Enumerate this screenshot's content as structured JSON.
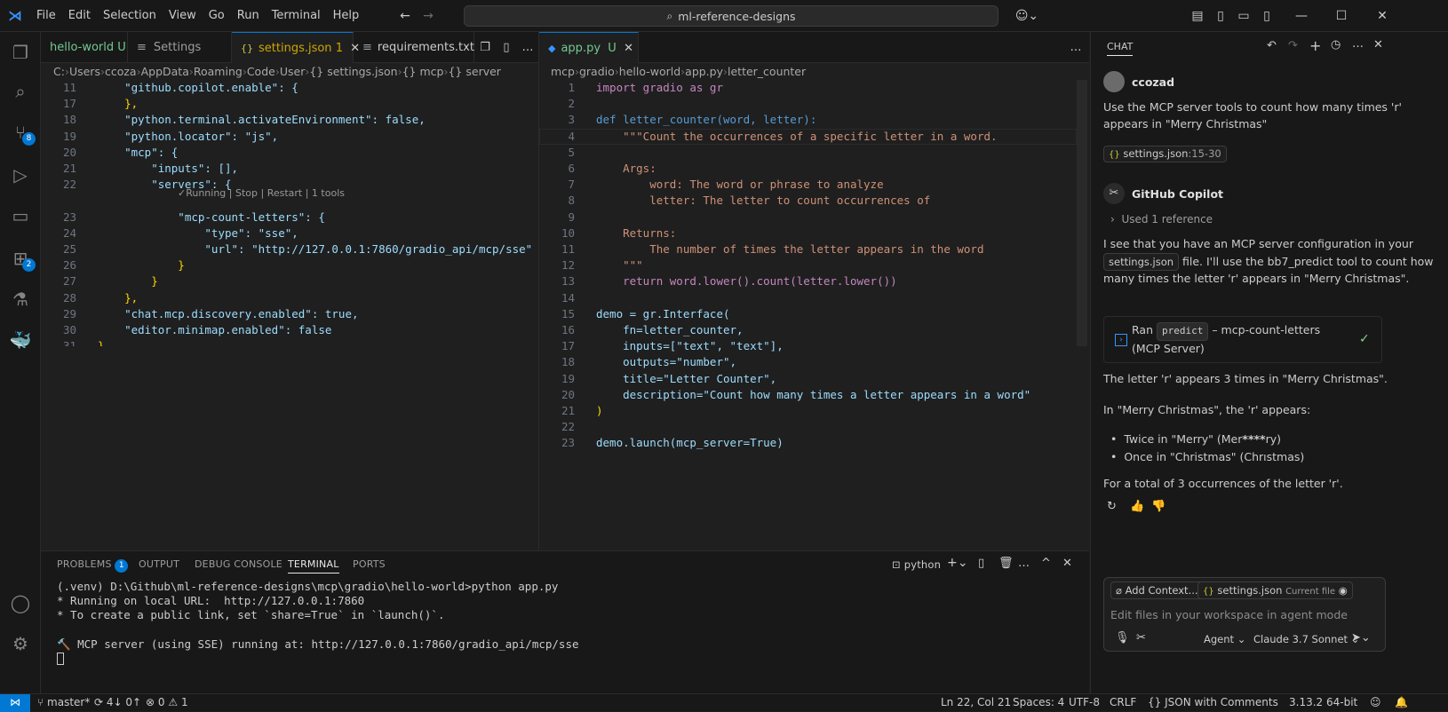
{
  "menu": [
    "File",
    "Edit",
    "Selection",
    "View",
    "Go",
    "Run",
    "Terminal",
    "Help"
  ],
  "search": "ml-reference-designs",
  "left_tabs": [
    {
      "label": "hello-world",
      "suffix": "U",
      "icon": ""
    },
    {
      "label": "Settings",
      "icon": "≡"
    },
    {
      "label": "settings.json",
      "suffix": "1",
      "icon": "{}"
    },
    {
      "label": "requirements.txt",
      "icon": "≡"
    }
  ],
  "right_tabs": [
    {
      "label": "app.py",
      "suffix": "U",
      "icon": "py"
    }
  ],
  "left_breadcrumb": [
    "C:",
    "Users",
    "ccoza",
    "AppData",
    "Roaming",
    "Code",
    "User",
    "{} settings.json",
    "{} mcp",
    "{} server"
  ],
  "right_breadcrumb": [
    "mcp",
    "gradio",
    "hello-world",
    "app.py",
    "letter_counter"
  ],
  "codelens": "✓Running | Stop | Restart | 1 tools",
  "left_lines": [
    {
      "n": "11",
      "t": "    \"github.copilot.enable\": {"
    },
    {
      "n": "17",
      "t": "    },"
    },
    {
      "n": "18",
      "t": "    \"python.terminal.activateEnvironment\": false,"
    },
    {
      "n": "19",
      "t": "    \"python.locator\": \"js\","
    },
    {
      "n": "20",
      "t": "    \"mcp\": {"
    },
    {
      "n": "21",
      "t": "        \"inputs\": [],"
    },
    {
      "n": "22",
      "t": "        \"servers\": {"
    },
    {
      "n": "23",
      "t": "            \"mcp-count-letters\": {"
    },
    {
      "n": "24",
      "t": "                \"type\": \"sse\","
    },
    {
      "n": "25",
      "t": "                \"url\": \"http://127.0.0.1:7860/gradio_api/mcp/sse\""
    },
    {
      "n": "26",
      "t": "            }"
    },
    {
      "n": "27",
      "t": "        }"
    },
    {
      "n": "28",
      "t": "    },"
    },
    {
      "n": "29",
      "t": "    \"chat.mcp.discovery.enabled\": true,"
    },
    {
      "n": "30",
      "t": "    \"editor.minimap.enabled\": false"
    },
    {
      "n": "31",
      "t": "}"
    }
  ],
  "right_lines": [
    {
      "n": "1",
      "t": "import gradio as gr"
    },
    {
      "n": "2",
      "t": ""
    },
    {
      "n": "3",
      "t": "def letter_counter(word, letter):"
    },
    {
      "n": "4",
      "t": "    \"\"\"Count the occurrences of a specific letter in a word."
    },
    {
      "n": "5",
      "t": "    "
    },
    {
      "n": "6",
      "t": "    Args:"
    },
    {
      "n": "7",
      "t": "        word: The word or phrase to analyze"
    },
    {
      "n": "8",
      "t": "        letter: The letter to count occurrences of"
    },
    {
      "n": "9",
      "t": "        "
    },
    {
      "n": "10",
      "t": "    Returns:"
    },
    {
      "n": "11",
      "t": "        The number of times the letter appears in the word"
    },
    {
      "n": "12",
      "t": "    \"\"\""
    },
    {
      "n": "13",
      "t": "    return word.lower().count(letter.lower())"
    },
    {
      "n": "14",
      "t": ""
    },
    {
      "n": "15",
      "t": "demo = gr.Interface("
    },
    {
      "n": "16",
      "t": "    fn=letter_counter,"
    },
    {
      "n": "17",
      "t": "    inputs=[\"text\", \"text\"],"
    },
    {
      "n": "18",
      "t": "    outputs=\"number\","
    },
    {
      "n": "19",
      "t": "    title=\"Letter Counter\","
    },
    {
      "n": "20",
      "t": "    description=\"Count how many times a letter appears in a word\""
    },
    {
      "n": "21",
      "t": ")"
    },
    {
      "n": "22",
      "t": ""
    },
    {
      "n": "23",
      "t": "demo.launch(mcp_server=True)"
    }
  ],
  "panel_tabs": [
    "PROBLEMS",
    "OUTPUT",
    "DEBUG CONSOLE",
    "TERMINAL",
    "PORTS"
  ],
  "problems_count": "1",
  "terminal_name": "python",
  "terminal_lines": [
    "(.venv) D:\\Github\\ml-reference-designs\\mcp\\gradio\\hello-world>python app.py",
    "* Running on local URL:  http://127.0.0.1:7860",
    "* To create a public link, set `share=True` in `launch()`.",
    "",
    "🔨 MCP server (using SSE) running at: http://127.0.0.1:7860/gradio_api/mcp/sse"
  ],
  "chat": {
    "title": "CHAT",
    "user": "ccozad",
    "prompt": "Use the MCP server tools to count how many times 'r' appears in \"Merry Christmas\"",
    "attachment": "settings.json",
    "attachment_range": ":15-30",
    "assistant": "GitHub Copilot",
    "used_ref": "Used 1 reference",
    "resp1a": "I see that you have an MCP server configuration in your ",
    "resp1file": "settings.json",
    "resp1b": " file. I'll use the bb7_predict tool to count how many times the letter 'r' appears in \"Merry Christmas\".",
    "ran_label": "Ran",
    "ran_tool": "predict",
    "ran_rest": " – mcp-count-letters (MCP Server)",
    "resp2": "The letter 'r' appears 3 times in \"Merry Christmas\".",
    "resp3": "In \"Merry Christmas\", the 'r' appears:",
    "bullet1a": "Twice in \"Merry\" (Mer",
    "bullet1b": "****",
    "bullet1c": "ry)",
    "bullet2": "Once in \"Christmas\" (Chrıstmas)",
    "resp4": "For a total of 3 occurrences of the letter 'r'.",
    "add_context": "Add Context...",
    "ctx_file": "settings.json",
    "ctx_current": "Current file",
    "input_placeholder": "Edit files in your workspace in agent mode",
    "mode": "Agent",
    "model": "Claude 3.7 Sonnet"
  },
  "status": {
    "branch": "master*",
    "sync": "4↓ 0↑",
    "errors": "0",
    "warnings": "1",
    "position": "Ln 22, Col 21",
    "spaces": "Spaces: 4",
    "encoding": "UTF-8",
    "eol": "CRLF",
    "language": "JSON with Comments",
    "python": "3.13.2 64-bit"
  }
}
